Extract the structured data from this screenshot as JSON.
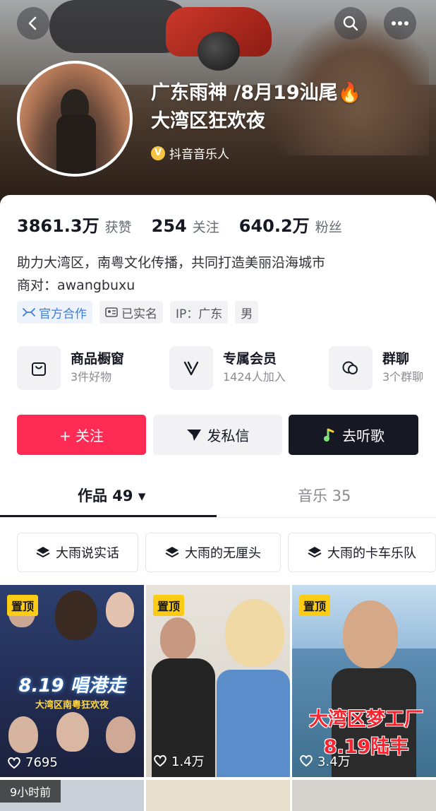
{
  "header": {
    "nickname_line1": "广东雨神 /8月19汕尾🔥",
    "nickname_line2": "大湾区狂欢夜",
    "verification": "抖音音乐人",
    "back_icon": "chevron-left-icon",
    "search_icon": "search-icon",
    "more_icon": "more-dots-icon"
  },
  "stats": [
    {
      "value": "3861.3万",
      "label": "获赞"
    },
    {
      "value": "254",
      "label": "关注"
    },
    {
      "value": "640.2万",
      "label": "粉丝"
    }
  ],
  "bio": {
    "line1": "助力大湾区，南粤文化传播，共同打造美丽沿海城市",
    "line2": "商对：awangbuxu"
  },
  "tags": {
    "official": "官方合作",
    "verified": "已实名",
    "ip": "IP：广东",
    "gender": "男"
  },
  "features": [
    {
      "title": "商品橱窗",
      "sub": "3件好物",
      "icon": "shopping-bag-icon"
    },
    {
      "title": "专属会员",
      "sub": "1424人加入",
      "icon": "vip-v-icon"
    },
    {
      "title": "群聊",
      "sub": "3个群聊",
      "icon": "chat-bubbles-icon"
    }
  ],
  "actions": {
    "follow": "+ 关注",
    "message": "发私信",
    "music": "去听歌"
  },
  "tabs": {
    "works": "作品 49 ▾",
    "music": "音乐 35"
  },
  "collections": [
    "大雨说实话",
    "大雨的无厘头",
    "大雨的卡车乐队"
  ],
  "videos": [
    {
      "pin": "置顶",
      "likes": "7695",
      "text_big": "8.19 唱港走",
      "text_small": "大湾区南粤狂欢夜"
    },
    {
      "pin": "置顶",
      "likes": "1.4万"
    },
    {
      "pin": "置顶",
      "likes": "3.4万",
      "overlay_line1": "大湾区梦工厂",
      "overlay_line2": "8.19陆丰"
    }
  ],
  "second_row": {
    "time_badge": "9小时前"
  },
  "colors": {
    "accent_red": "#fe2c55",
    "dark": "#161823",
    "pin_yellow": "#facc15",
    "official_blue": "#3d7fd9"
  }
}
